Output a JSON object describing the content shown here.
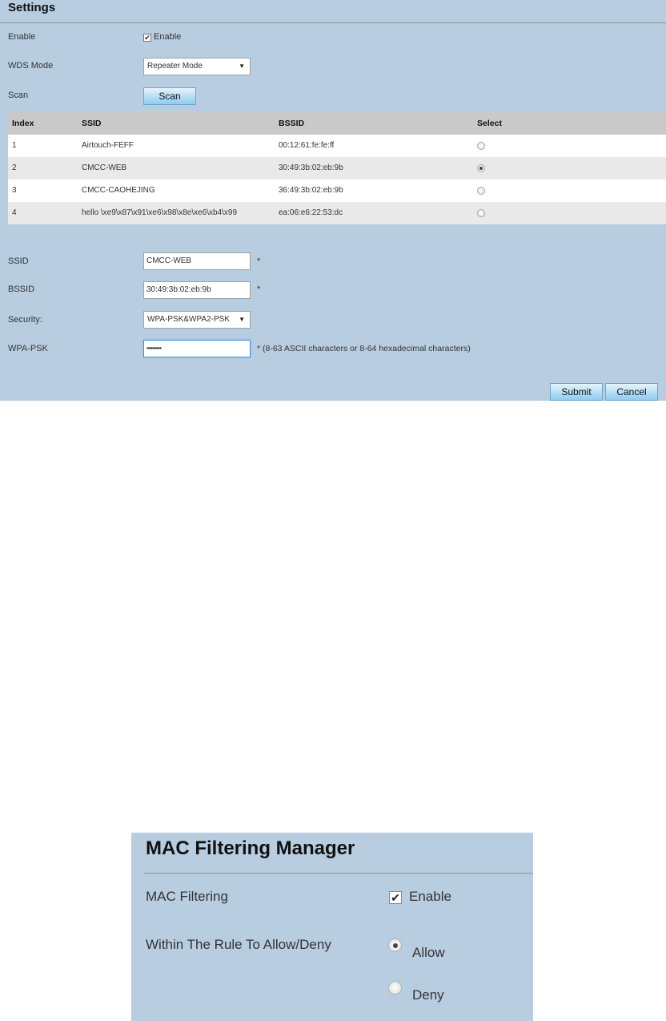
{
  "settings": {
    "title": "Settings",
    "enable": {
      "label": "Enable",
      "checkbox_label": "Enable",
      "checked": true
    },
    "wds_mode": {
      "label": "WDS Mode",
      "value": "Repeater Mode"
    },
    "scan": {
      "label": "Scan",
      "button": "Scan"
    },
    "table": {
      "headers": [
        "Index",
        "SSID",
        "BSSID",
        "Select"
      ],
      "rows": [
        {
          "index": "1",
          "ssid": "Airtouch-FEFF",
          "bssid": "00:12:61:fe:fe:ff",
          "selected": false
        },
        {
          "index": "2",
          "ssid": "CMCC-WEB",
          "bssid": "30:49:3b:02:eb:9b",
          "selected": true
        },
        {
          "index": "3",
          "ssid": "CMCC-CAOHEJING",
          "bssid": "36:49:3b:02:eb:9b",
          "selected": false
        },
        {
          "index": "4",
          "ssid": "hello \\xe9\\x87\\x91\\xe6\\x98\\x8e\\xe6\\xb4\\x99",
          "bssid": "ea:06:e6:22:53:dc",
          "selected": false
        }
      ]
    },
    "ssid": {
      "label": "SSID",
      "value": "CMCC-WEB",
      "required": "*"
    },
    "bssid": {
      "label": "BSSID",
      "value": "30:49:3b:02:eb:9b",
      "required": "*"
    },
    "security": {
      "label": "Security:",
      "value": "WPA-PSK&WPA2-PSK"
    },
    "wpa_psk": {
      "label": "WPA-PSK",
      "value": "••••••••••",
      "hint": "*  (8-63 ASCII characters or 8-64 hexadecimal characters)"
    },
    "submit": "Submit",
    "cancel": "Cancel"
  },
  "mac_filtering": {
    "title": "MAC Filtering Manager",
    "mac_label": "MAC Filtering",
    "enable_label": "Enable",
    "enable_checked": true,
    "rule_label": "Within The Rule To Allow/Deny",
    "allow_label": "Allow",
    "deny_label": "Deny",
    "selected": "Allow"
  }
}
